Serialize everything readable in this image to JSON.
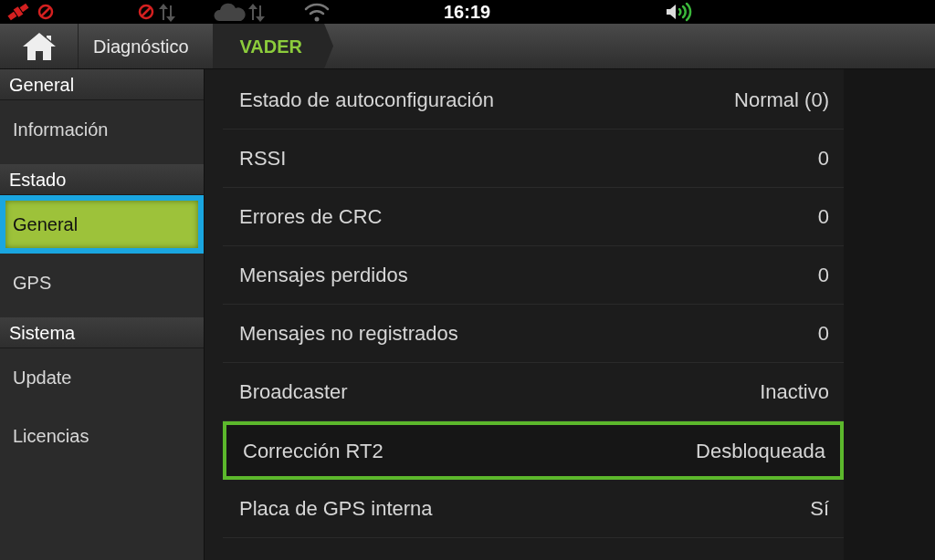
{
  "status_bar": {
    "time": "16:19"
  },
  "breadcrumb": [
    {
      "label": "Diagnóstico",
      "selected": false
    },
    {
      "label": "VADER",
      "selected": true
    }
  ],
  "sidebar": [
    {
      "header": "General",
      "items": [
        {
          "label": "Información",
          "selected": false
        }
      ]
    },
    {
      "header": "Estado",
      "items": [
        {
          "label": "General",
          "selected": true
        },
        {
          "label": "GPS",
          "selected": false
        }
      ]
    },
    {
      "header": "Sistema",
      "items": [
        {
          "label": "Update",
          "selected": false
        },
        {
          "label": "Licencias",
          "selected": false
        }
      ]
    }
  ],
  "rows": [
    {
      "label": "Estado de autoconfiguración",
      "value": "Normal (0)",
      "highlighted": false
    },
    {
      "label": "RSSI",
      "value": "0",
      "highlighted": false
    },
    {
      "label": "Errores de CRC",
      "value": "0",
      "highlighted": false
    },
    {
      "label": "Mensajes perdidos",
      "value": "0",
      "highlighted": false
    },
    {
      "label": "Mensajes no registrados",
      "value": "0",
      "highlighted": false
    },
    {
      "label": "Broadcaster",
      "value": "Inactivo",
      "highlighted": false
    },
    {
      "label": "Corrección RT2",
      "value": "Desbloqueada",
      "highlighted": true
    },
    {
      "label": "Placa de GPS interna",
      "value": "Sí",
      "highlighted": false
    }
  ]
}
